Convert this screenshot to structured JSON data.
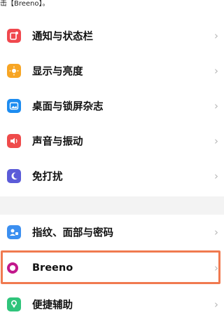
{
  "hint": {
    "text": "击【Breeno】。"
  },
  "colors": {
    "notify": "#f0484e",
    "display": "#f7a524",
    "wallpaper": "#1d8cf0",
    "sound": "#ef4b4b",
    "dnd": "#5b5bd8",
    "fingerprint": "#3b8ff0",
    "breeno": "#c2188c",
    "access": "#2fc47b",
    "highlight": "#f07a50"
  },
  "menu": [
    {
      "id": "notify",
      "label": "通知与状态栏",
      "icon": "notification-icon"
    },
    {
      "id": "display",
      "label": "显示与亮度",
      "icon": "brightness-icon"
    },
    {
      "id": "wallpaper",
      "label": "桌面与锁屏杂志",
      "icon": "wallpaper-icon"
    },
    {
      "id": "sound",
      "label": "声音与振动",
      "icon": "speaker-icon"
    },
    {
      "id": "dnd",
      "label": "免打扰",
      "icon": "moon-icon"
    }
  ],
  "menu2": [
    {
      "id": "fingerprint",
      "label": "指纹、面部与密码",
      "icon": "fingerprint-icon"
    },
    {
      "id": "breeno",
      "label": "Breeno",
      "icon": "breeno-icon"
    },
    {
      "id": "access",
      "label": "便捷辅助",
      "icon": "accessibility-icon"
    }
  ],
  "chevron": "›"
}
